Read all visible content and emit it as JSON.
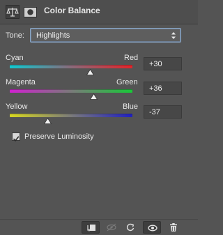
{
  "panel": {
    "title": "Color Balance"
  },
  "tone": {
    "label": "Tone:",
    "selected": "Highlights"
  },
  "sliders": [
    {
      "left_label": "Cyan",
      "right_label": "Red",
      "value": "+30"
    },
    {
      "left_label": "Magenta",
      "right_label": "Green",
      "value": "+36"
    },
    {
      "left_label": "Yellow",
      "right_label": "Blue",
      "value": "-37"
    }
  ],
  "preserve_luminosity": {
    "label": "Preserve Luminosity",
    "checked": true
  },
  "colors": {
    "panel_bg": "#545454",
    "cyan": "#12c8d0",
    "red": "#e2242a",
    "magenta": "#d020d0",
    "green": "#18c838",
    "yellow": "#d8d820",
    "blue": "#2020c0"
  },
  "icons": {
    "header": [
      "balance-scale-icon",
      "layer-mask-icon"
    ],
    "bottom": [
      "clip-to-layer-icon",
      "view-previous-state-icon",
      "reset-icon",
      "visibility-eye-icon",
      "trash-icon"
    ]
  }
}
